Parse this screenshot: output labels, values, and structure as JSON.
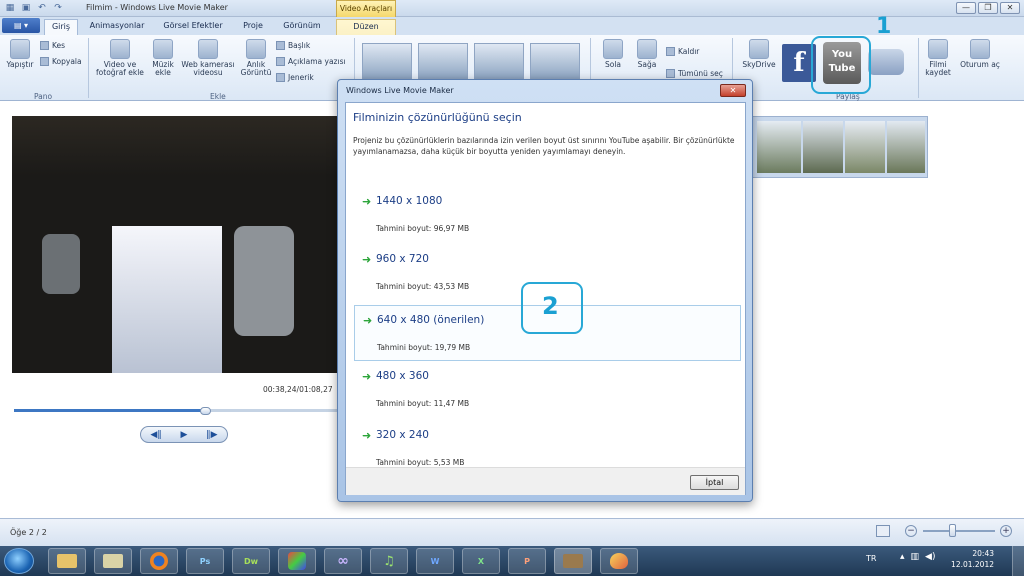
{
  "window": {
    "title": "Filmim - Windows Live Movie Maker",
    "context_header": "Video Araçları",
    "buttons": [
      "—",
      "❐",
      "✕"
    ]
  },
  "tabs": [
    {
      "label": "Giriş"
    },
    {
      "label": "Animasyonlar"
    },
    {
      "label": "Görsel Efektler"
    },
    {
      "label": "Proje"
    },
    {
      "label": "Görünüm"
    },
    {
      "label": "Düzen"
    }
  ],
  "ribbon": {
    "pano": {
      "paste": "Yapıştır",
      "cut": "Kes",
      "copy": "Kopyala",
      "group": "Pano"
    },
    "ekle": {
      "add_video": "Video ve fotoğraf ekle",
      "music": "Müzik ekle",
      "webcam": "Web kamerası videosu",
      "snapshot": "Anlık Görüntü",
      "title": "Başlık",
      "caption": "Açıklama yazısı",
      "credits": "Jenerik",
      "group": "Ekle"
    },
    "rotate": {
      "left": "Sola",
      "right": "Sağa",
      "remove": "Kaldır",
      "select_all": "Tümünü seç"
    },
    "share": {
      "skydrive": "SkyDrive",
      "youtube": "You Tube",
      "group": "Paylaş"
    },
    "save_movie": "Filmi kaydet",
    "signin": "Oturum aç"
  },
  "annotations": {
    "one": "1",
    "two": "2"
  },
  "player": {
    "timecode": "00:38,24/01:08,27",
    "progress": 0.59
  },
  "status": {
    "item_count": "Öğe 2 / 2"
  },
  "dialog": {
    "title": "Windows Live Movie Maker",
    "heading": "Filminizin çözünürlüğünü seçin",
    "description": "Projeniz bu çözünürlüklerin bazılarında izin verilen boyut üst sınırını YouTube aşabilir. Bir çözünürlükte yayımlanamazsa, daha küçük bir boyutta yeniden yayımlamayı deneyin.",
    "options": [
      {
        "res": "1440 x 1080",
        "size": "Tahmini boyut: 96,97 MB"
      },
      {
        "res": "960 x 720",
        "size": "Tahmini boyut: 43,53 MB"
      },
      {
        "res": "640 x 480 (önerilen)",
        "size": "Tahmini boyut: 19,79 MB"
      },
      {
        "res": "480 x 360",
        "size": "Tahmini boyut: 11,47 MB"
      },
      {
        "res": "320 x 240",
        "size": "Tahmini boyut: 5,53 MB"
      }
    ],
    "cancel": "İptal"
  },
  "taskbar": {
    "apps": [
      "explorer",
      "folder",
      "firefox",
      "Ps",
      "Dw",
      "palette-app",
      "infinity-app",
      "music-app",
      "W",
      "X",
      "P",
      "movie-maker",
      "paint"
    ],
    "lang": "TR",
    "time": "20:43",
    "date": "12.01.2012"
  }
}
